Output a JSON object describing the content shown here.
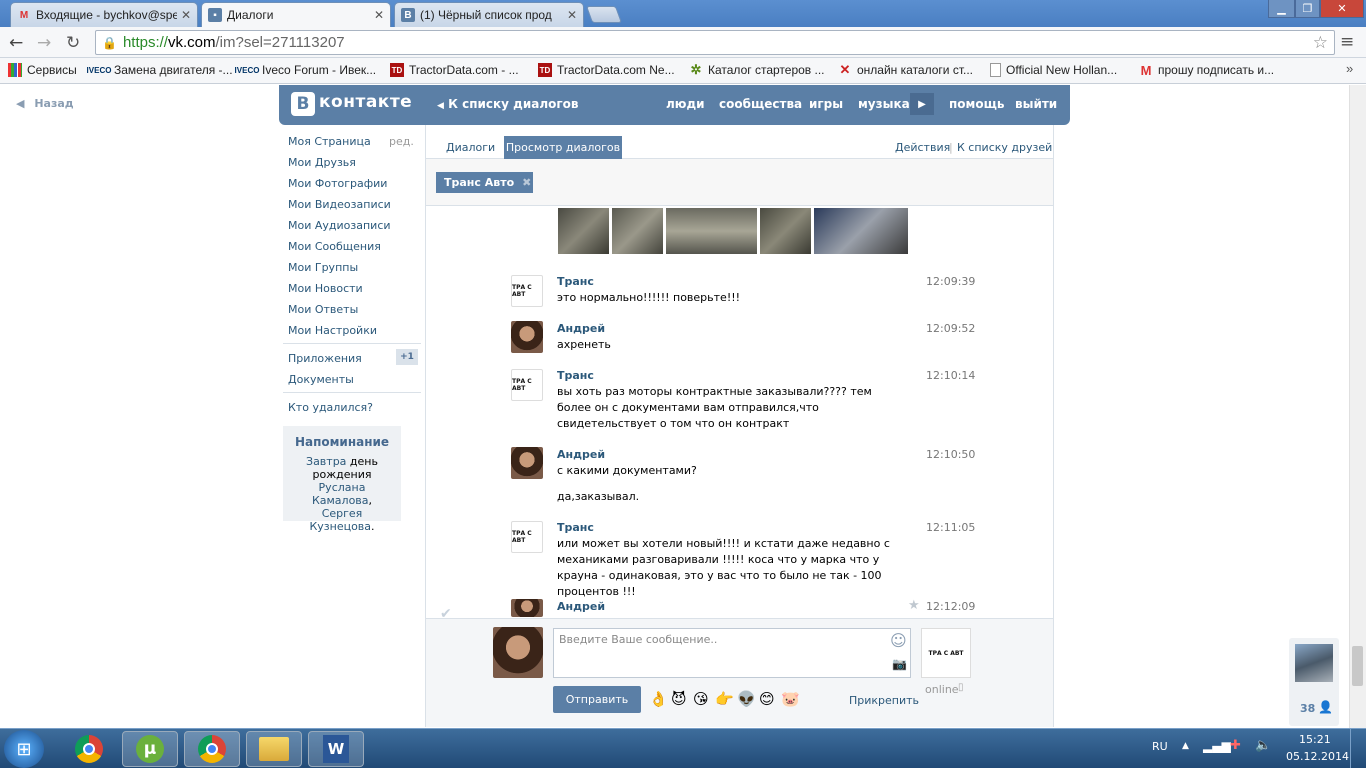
{
  "browser": {
    "tabs": [
      {
        "label": "Входящие - bychkov@spe",
        "icon": "gmail-icon"
      },
      {
        "label": "Диалоги",
        "icon": "vk-chat-icon"
      },
      {
        "label": "(1) Чёрный список прод",
        "icon": "vk-icon"
      }
    ],
    "url_scheme": "https://",
    "url_host": "vk.com",
    "url_path": "/im?sel=271113207",
    "bookmarks": [
      {
        "label": "Сервисы",
        "icon": "apps-grid-icon"
      },
      {
        "label": "Замена двигателя -...",
        "icon": "iveco-icon",
        "icon_text": "IVECO"
      },
      {
        "label": "Iveco Forum - Ивек...",
        "icon": "iveco-icon",
        "icon_text": "IVECO"
      },
      {
        "label": "TractorData.com - ...",
        "icon": "td-icon",
        "icon_text": "TD"
      },
      {
        "label": "TractorData.com Ne...",
        "icon": "td-icon",
        "icon_text": "TD"
      },
      {
        "label": "Каталог стартеров ...",
        "icon": "gear-icon",
        "icon_text": "✲"
      },
      {
        "label": "онлайн каталоги ст...",
        "icon": "cross-icon",
        "icon_text": "✕"
      },
      {
        "label": "Official New Hollan...",
        "icon": "page-icon",
        "icon_text": ""
      },
      {
        "label": "прошу подписать и...",
        "icon": "gmail-icon",
        "icon_text": "M"
      }
    ]
  },
  "vk": {
    "logo_text": "контакте",
    "logo_letter": "В",
    "back_to_list": "К списку диалогов",
    "nav": [
      "люди",
      "сообщества",
      "игры",
      "музыка",
      "помощь",
      "выйти"
    ],
    "back_label": "Назад",
    "menu": [
      "Моя Страница",
      "Мои Друзья",
      "Мои Фотографии",
      "Мои Видеозаписи",
      "Мои Аудиозаписи",
      "Мои Сообщения",
      "Мои Группы",
      "Мои Новости",
      "Мои Ответы",
      "Мои Настройки"
    ],
    "menu_edit": "ред.",
    "menu2": [
      "Приложения",
      "Документы"
    ],
    "apps_badge": "+1",
    "menu3": "Кто удалился?",
    "reminder": {
      "title": "Напоминание",
      "tomorrow": "Завтра",
      "text1": " день рождения ",
      "name1": "Руслана Камалова",
      "sep": ", ",
      "name2": "Сергея Кузнецова",
      "end": "."
    },
    "tabs": {
      "dialogs": "Диалоги",
      "view": "Просмотр диалогов",
      "actions": "Действия",
      "divider": "|",
      "friends": "К списку друзей"
    },
    "chip": "Транс Авто",
    "messages": [
      {
        "name": "Транс",
        "time": "12:09:39",
        "text": "это нормально!!!!!! поверьте!!!",
        "avatar": "trans"
      },
      {
        "name": "Андрей",
        "time": "12:09:52",
        "text": "ахренеть",
        "avatar": "andrey"
      },
      {
        "name": "Транс",
        "time": "12:10:14",
        "text": "вы хоть раз моторы контрактные заказывали???? тем более он с документами вам отправился,что свидетельствует о том что он контракт",
        "avatar": "trans"
      },
      {
        "name": "Андрей",
        "time": "12:10:50",
        "text": "с какими документами?",
        "text2": "да,заказывал.",
        "avatar": "andrey"
      },
      {
        "name": "Транс",
        "time": "12:11:05",
        "text": "или может вы хотели новый!!!! и кстати даже недавно с механиками разговаривали !!!!! коса что у марка что у крауна - одинаковая, это у вас что то было не так - 100 процентов !!!",
        "avatar": "trans"
      },
      {
        "name": "Андрей",
        "time": "12:12:09",
        "text": "",
        "avatar": "andrey"
      }
    ],
    "avatar_trans_text": "ТРА  С АВТ",
    "composer": {
      "placeholder": "Введите Ваше сообщение..",
      "send": "Отправить",
      "attach": "Прикрепить",
      "online": "online",
      "emojis": [
        "👌",
        "😈",
        "😘",
        "👉",
        "👽",
        "😊",
        "🐷"
      ]
    },
    "side_count": "38"
  },
  "taskbar": {
    "lang": "RU",
    "time": "15:21",
    "date": "05.12.2014"
  },
  "colors": {
    "vk_blue": "#5b7fa6",
    "vk_link": "#2b587a",
    "taskbar": "#214a76"
  }
}
